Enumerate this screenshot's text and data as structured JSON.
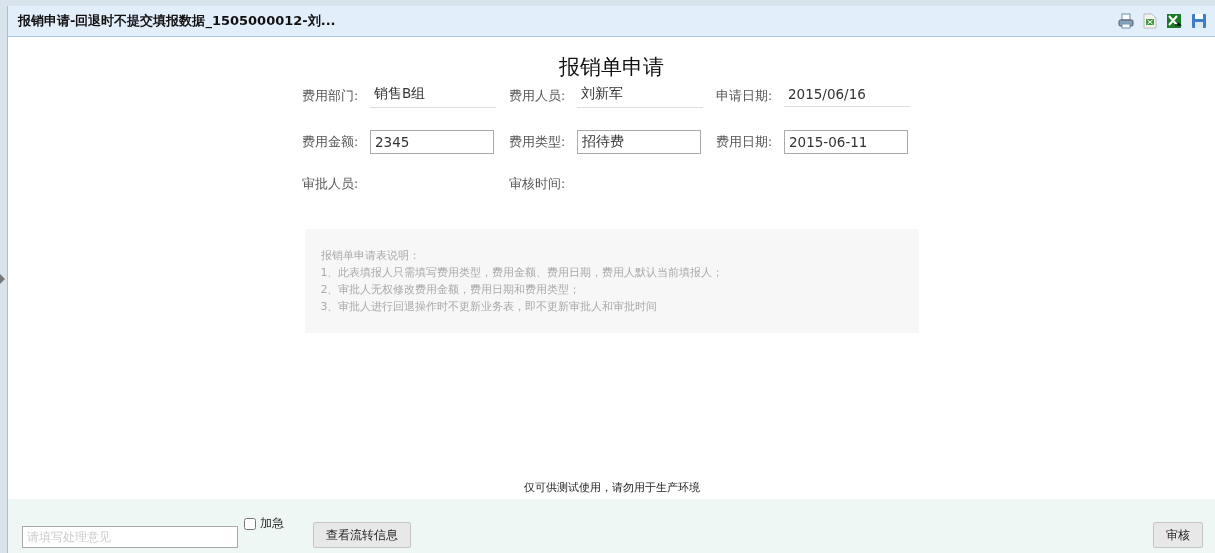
{
  "window": {
    "title": "报销申请-回退时不提交填报数据_1505000012-刘..."
  },
  "form": {
    "title": "报销单申请",
    "rows": [
      [
        {
          "label": "费用部门:",
          "kind": "line",
          "value": "销售B组"
        },
        {
          "label": "费用人员:",
          "kind": "line",
          "value": "刘新军"
        },
        {
          "label": "申请日期:",
          "kind": "line",
          "value": "2015/06/16"
        }
      ],
      [
        {
          "label": "费用金额:",
          "kind": "box",
          "value": "2345"
        },
        {
          "label": "费用类型:",
          "kind": "box",
          "value": "招待费"
        },
        {
          "label": "费用日期:",
          "kind": "box",
          "value": "2015-06-11"
        }
      ],
      [
        {
          "label": "审批人员:",
          "kind": "empty"
        },
        {
          "label": "审核时间:",
          "kind": "empty"
        }
      ]
    ],
    "notes": [
      "报销单申请表说明：",
      "1、此表填报人只需填写费用类型，费用金额、费用日期，费用人默认当前填报人；",
      "2、审批人无权修改费用金额，费用日期和费用类型；",
      "3、审批人进行回退操作时不更新业务表，即不更新审批人和审批时间"
    ]
  },
  "notice": "仅可供测试使用，请勿用于生产环境",
  "footer": {
    "opinion": {
      "placeholder": "请填写处理意见"
    },
    "urgent": {
      "label": "加急",
      "checked": false
    },
    "buttons": [
      "查看流转信息",
      "审核"
    ]
  }
}
